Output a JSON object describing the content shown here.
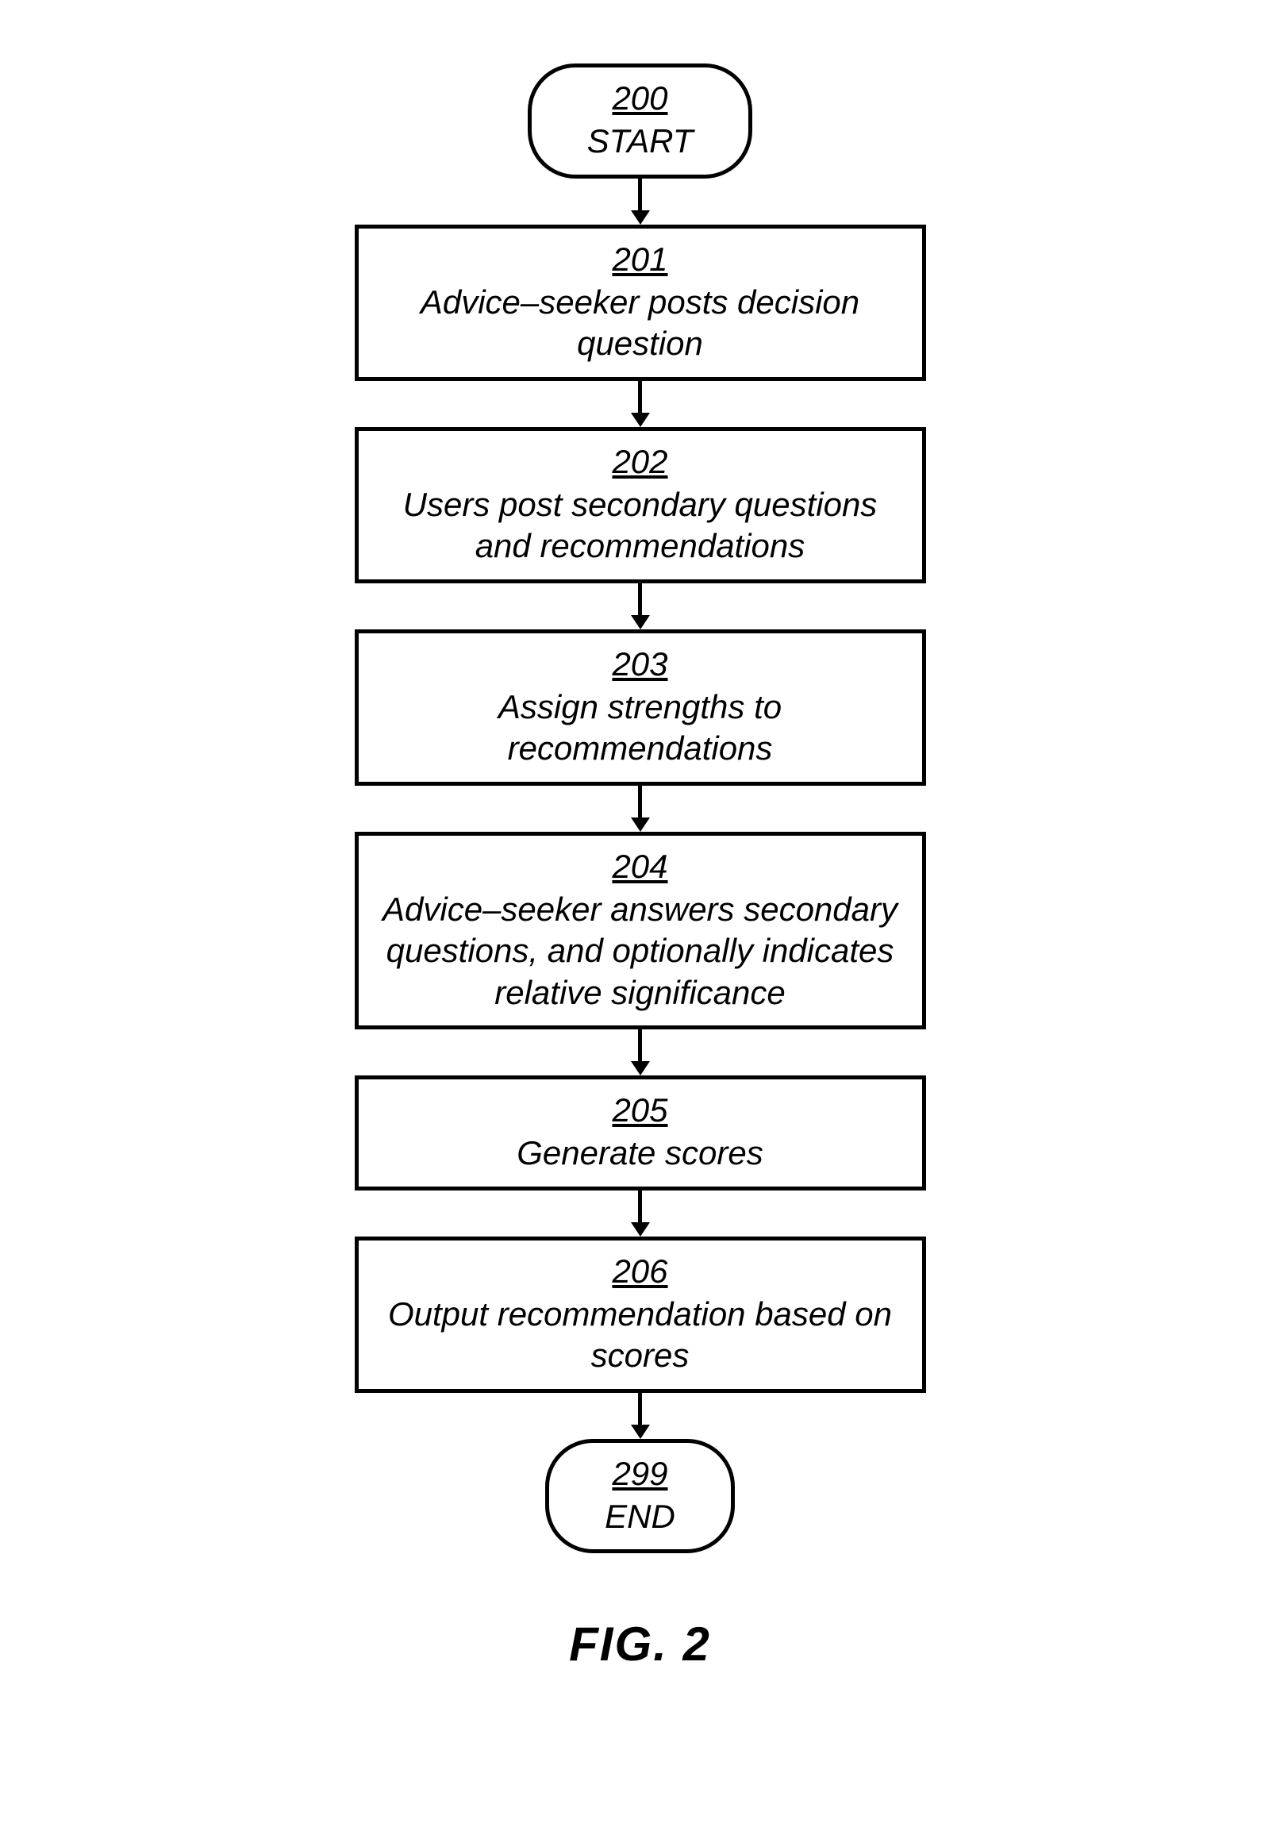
{
  "flowchart": {
    "start": {
      "number": "200",
      "label": "START"
    },
    "steps": [
      {
        "number": "201",
        "label": "Advice–seeker posts decision question"
      },
      {
        "number": "202",
        "label": "Users post secondary questions and recommendations"
      },
      {
        "number": "203",
        "label": "Assign strengths to recommendations"
      },
      {
        "number": "204",
        "label": "Advice–seeker answers secondary questions, and optionally indicates relative significance"
      },
      {
        "number": "205",
        "label": "Generate scores"
      },
      {
        "number": "206",
        "label": "Output recommendation based on scores"
      }
    ],
    "end": {
      "number": "299",
      "label": "END"
    }
  },
  "figure_label": "FIG. 2"
}
